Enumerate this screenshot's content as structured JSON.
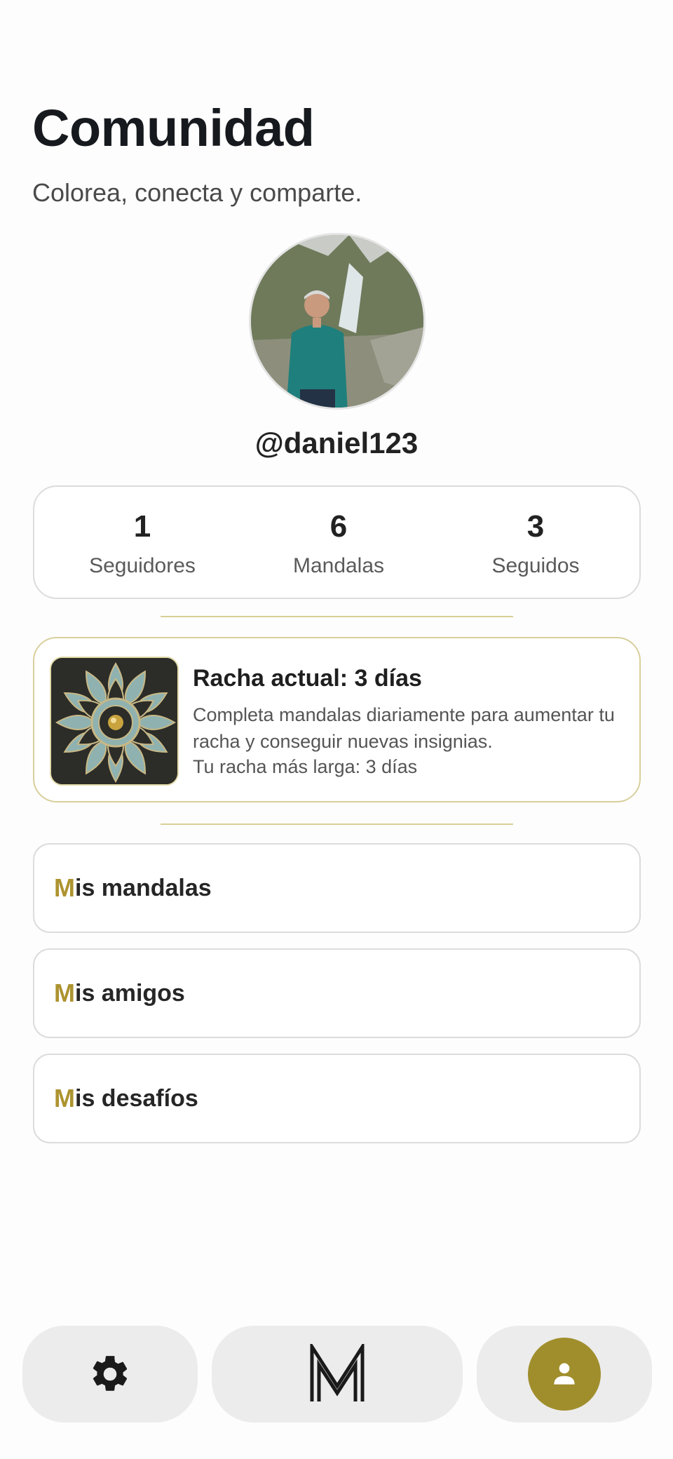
{
  "header": {
    "title": "Comunidad",
    "subtitle": "Colorea, conecta y comparte."
  },
  "profile": {
    "username": "@daniel123"
  },
  "stats": [
    {
      "value": "1",
      "label": "Seguidores"
    },
    {
      "value": "6",
      "label": "Mandalas"
    },
    {
      "value": "3",
      "label": "Seguidos"
    }
  ],
  "streak": {
    "title": "Racha actual: 3 días",
    "description": "Completa mandalas diariamente para aumentar tu racha y conseguir nuevas insignias.",
    "record": "Tu racha más larga: 3 días"
  },
  "menu": [
    {
      "initial": "M",
      "rest": "is mandalas"
    },
    {
      "initial": "M",
      "rest": "is amigos"
    },
    {
      "initial": "M",
      "rest": "is desafíos"
    }
  ],
  "bottom_nav": {
    "items": [
      {
        "icon": "gear-icon",
        "active": false
      },
      {
        "icon": "m-logo-icon",
        "active": false
      },
      {
        "icon": "person-icon",
        "active": true
      }
    ]
  },
  "colors": {
    "accent": "#a08e2c",
    "accent_text": "#ad9330",
    "divider": "#d9cf95",
    "nav_bg": "#ececec"
  }
}
